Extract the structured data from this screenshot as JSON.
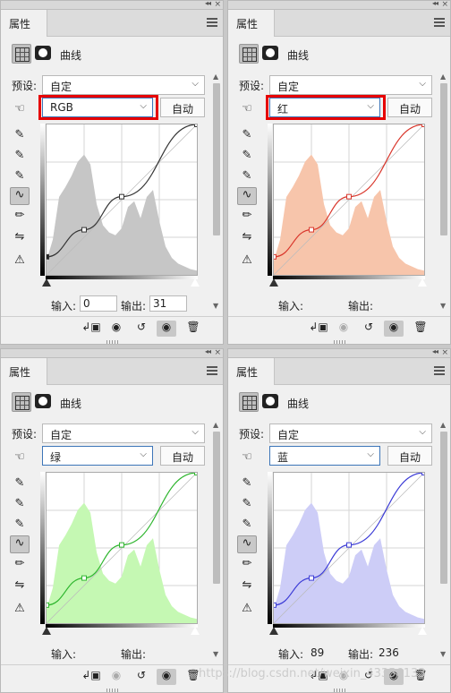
{
  "panels": [
    {
      "tab_label": "属性",
      "title": "曲线",
      "preset_label": "预设:",
      "preset_value": "自定",
      "channel_value": "RGB",
      "auto_label": "自动",
      "input_label": "输入:",
      "input_value": "0",
      "output_label": "输出:",
      "output_value": "31",
      "highlighted": true,
      "curve_color": "#333333",
      "hist_color": "#c6c6c6"
    },
    {
      "tab_label": "属性",
      "title": "曲线",
      "preset_label": "预设:",
      "preset_value": "自定",
      "channel_value": "红",
      "auto_label": "自动",
      "input_label": "输入:",
      "input_value": "",
      "output_label": "输出:",
      "output_value": "",
      "highlighted": true,
      "curve_color": "#d9362b",
      "hist_color": "#f7c5ab"
    },
    {
      "tab_label": "属性",
      "title": "曲线",
      "preset_label": "预设:",
      "preset_value": "自定",
      "channel_value": "绿",
      "auto_label": "自动",
      "input_label": "输入:",
      "input_value": "",
      "output_label": "输出:",
      "output_value": "",
      "highlighted": false,
      "curve_color": "#2db52d",
      "hist_color": "#c5f8b3"
    },
    {
      "tab_label": "属性",
      "title": "曲线",
      "preset_label": "预设:",
      "preset_value": "自定",
      "channel_value": "蓝",
      "auto_label": "自动",
      "input_label": "输入:",
      "input_value": "89",
      "output_label": "输出:",
      "output_value": "236",
      "highlighted": false,
      "curve_color": "#3b3bd6",
      "hist_color": "#cdcdf7"
    }
  ],
  "watermark": "https://blog.csdn.net/weixin_43356133"
}
